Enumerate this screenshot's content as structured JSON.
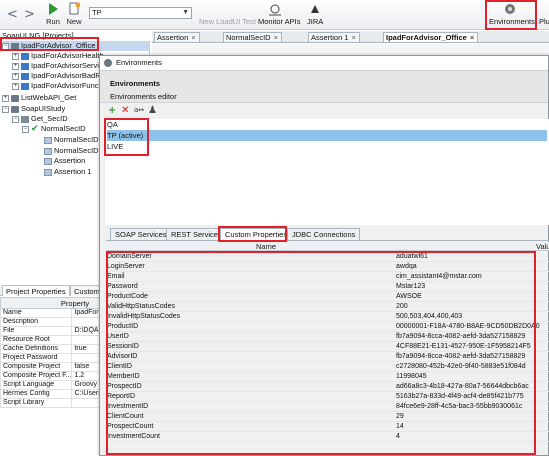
{
  "toolbar": {
    "run": "Run",
    "new": "New",
    "project_select": "TP",
    "new_loadui": "New LoadUI Test",
    "monitor": "Monitor APIs",
    "jira": "JIRA",
    "environments": "Environments",
    "plugins": "Plu"
  },
  "navigator": {
    "title": "SoapUI NG [Projects]",
    "rows": [
      {
        "label": "IpadForAdvisor_Office"
      },
      {
        "label": "IpadForAdvisorHealth"
      },
      {
        "label": "IpadForAdvisorServic"
      },
      {
        "label": "IpadForAdvisorBadRe"
      },
      {
        "label": "IpadForAdvisorFunctio"
      },
      {
        "label": "ListWebAPI_Get"
      },
      {
        "label": "SoapUIStudy"
      },
      {
        "label": "Get_SecID"
      },
      {
        "label": "NormalSecID"
      },
      {
        "label": "NormalSecID"
      },
      {
        "label": "NormalSecID"
      },
      {
        "label": "Assertion"
      },
      {
        "label": "Assertion 1"
      }
    ]
  },
  "props_panel": {
    "tabs": [
      "Project Properties",
      "Custom P"
    ],
    "header": "Property",
    "rows": [
      {
        "k": "Name",
        "v": "IpadFor"
      },
      {
        "k": "Description",
        "v": ""
      },
      {
        "k": "File",
        "v": "D:\\DQAu"
      },
      {
        "k": "Resource Root",
        "v": ""
      },
      {
        "k": "Cache Definitions",
        "v": "true"
      },
      {
        "k": "Project Password",
        "v": ""
      },
      {
        "k": "Composite Project",
        "v": "false"
      },
      {
        "k": "Composite Project F...",
        "v": "1.2"
      },
      {
        "k": "Script Language",
        "v": "Groovy"
      },
      {
        "k": "Hermes Config",
        "v": "C:\\Users"
      },
      {
        "k": "Script Library",
        "v": ""
      }
    ]
  },
  "editor_tabs": [
    {
      "label": "Assertion"
    },
    {
      "label": "NormalSecID"
    },
    {
      "label": "Assertion 1"
    },
    {
      "label": "IpadForAdvisor_Office"
    }
  ],
  "dialog": {
    "title": "Environments",
    "header_title": "Environments",
    "header_sub": "Environments editor",
    "tools": {
      "add": "+",
      "delete": "✕",
      "rename": "a↔",
      "person": "♟"
    },
    "environments": [
      "QA",
      "TP (active)",
      "LIVE"
    ],
    "subtabs": [
      "SOAP Services",
      "REST Services",
      "Custom Properties",
      "JDBC Connections"
    ],
    "columns": {
      "name": "Name",
      "value": "Value"
    },
    "properties": [
      {
        "n": "DomainServer",
        "v": "aduatwl61"
      },
      {
        "n": "LoginServer",
        "v": "awdqa"
      },
      {
        "n": "Email",
        "v": "cim_assistant4@mstar.com"
      },
      {
        "n": "Password",
        "v": "Mstar123"
      },
      {
        "n": "ProductCode",
        "v": "AWSOE"
      },
      {
        "n": "ValidHttpStatusCodes",
        "v": "200"
      },
      {
        "n": "InvalidHttpStatusCodes",
        "v": "500,503,404,400,403"
      },
      {
        "n": "ProductID",
        "v": "00000001-F18A-4780-B8AE-9CD50DB2D0A0"
      },
      {
        "n": "UserID",
        "v": "fb7a9094-8cca-4082-aefd-3da527158829"
      },
      {
        "n": "SessionID",
        "v": "4CF88E21-E131-4527-950E-1F5958214F5"
      },
      {
        "n": "AdvisorID",
        "v": "fb7a9094-8cca-4082-aefd-3da527158829"
      },
      {
        "n": "ClientID",
        "v": "c2728080-452b-42e0-9f40-5883e51f084d"
      },
      {
        "n": "MemberID",
        "v": "11998045"
      },
      {
        "n": "ProspectID",
        "v": "ad66a8c3-4b18-427a-80a7-56644dbcb6ac"
      },
      {
        "n": "ReportID",
        "v": "5163b27a-833d-4f49-acf4-de85f421b775"
      },
      {
        "n": "InvestmentID",
        "v": "84fce6e9-28ff-4c5a-bac3-55bb9030061c"
      },
      {
        "n": "ClientCount",
        "v": "29"
      },
      {
        "n": "ProspectCount",
        "v": "14"
      },
      {
        "n": "InvestmentCount",
        "v": "4"
      }
    ]
  },
  "colors": {
    "highlight": "#e0202a",
    "selection": "#8fc2ea"
  }
}
